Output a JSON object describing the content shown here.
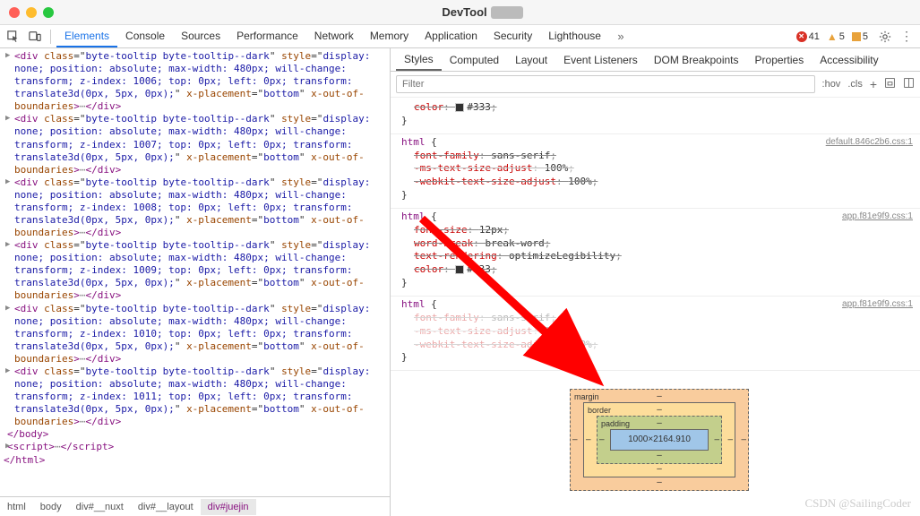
{
  "window": {
    "title": "DevTool"
  },
  "tabs": {
    "items": [
      "Elements",
      "Console",
      "Sources",
      "Performance",
      "Network",
      "Memory",
      "Application",
      "Security",
      "Lighthouse"
    ],
    "active": 0
  },
  "errors": {
    "error_count": "41",
    "warn_count": "5",
    "issue_count": "5"
  },
  "subtabs": {
    "items": [
      "Styles",
      "Computed",
      "Layout",
      "Event Listeners",
      "DOM Breakpoints",
      "Properties",
      "Accessibility"
    ],
    "active": 0
  },
  "filter": {
    "placeholder": "Filter",
    "opts": [
      ":hov",
      ".cls"
    ]
  },
  "dom_nodes": [
    {
      "tag": "div",
      "class": "byte-tooltip byte-tooltip--dark",
      "style": "display: none; position: absolute; max-width: 480px; will-change: transform; z-index: 1006; top: 0px; left: 0px; transform: translate3d(0px, 5px, 0px);",
      "xpl": "bottom",
      "xob": true
    },
    {
      "tag": "div",
      "class": "byte-tooltip byte-tooltip--dark",
      "style": "display: none; position: absolute; max-width: 480px; will-change: transform; z-index: 1007; top: 0px; left: 0px; transform: translate3d(0px, 5px, 0px);",
      "xpl": "bottom",
      "xob": true
    },
    {
      "tag": "div",
      "class": "byte-tooltip byte-tooltip--dark",
      "style": "display: none; position: absolute; max-width: 480px; will-change: transform; z-index: 1008; top: 0px; left: 0px; transform: translate3d(0px, 5px, 0px);",
      "xpl": "bottom",
      "xob": true
    },
    {
      "tag": "div",
      "class": "byte-tooltip byte-tooltip--dark",
      "style": "display: none; position: absolute; max-width: 480px; will-change: transform; z-index: 1009; top: 0px; left: 0px; transform: translate3d(0px, 5px, 0px);",
      "xpl": "bottom",
      "xob": true
    },
    {
      "tag": "div",
      "class": "byte-tooltip byte-tooltip--dark",
      "style": "display: none; position: absolute; max-width: 480px; will-change: transform; z-index: 1010; top: 0px; left: 0px; transform: translate3d(0px, 5px, 0px);",
      "xpl": "bottom",
      "xob": true
    },
    {
      "tag": "div",
      "class": "byte-tooltip byte-tooltip--dark",
      "style": "display: none; position: absolute; max-width: 480px; will-change: transform; z-index: 1011; top: 0px; left: 0px; transform: translate3d(0px, 5px, 0px);",
      "xpl": "bottom",
      "xob": true
    }
  ],
  "dom_tail": {
    "body_close": "</body>",
    "script_open": "<script>",
    "script_close": "</script>",
    "html_close": "</html>"
  },
  "crumbs": {
    "items": [
      "html",
      "body",
      "div#__nuxt",
      "div#__layout",
      "div#juejin"
    ],
    "selected": 4
  },
  "rules": [
    {
      "selector": "",
      "source": "",
      "props": [
        {
          "k": "color",
          "v": "#333",
          "sw": true,
          "strike": true
        }
      ],
      "close": "}"
    },
    {
      "selector": "html {",
      "source": "default.846c2b6.css:1",
      "props": [
        {
          "k": "font-family",
          "v": "sans-serif",
          "strike": true
        },
        {
          "k": "-ms-text-size-adjust",
          "v": "100%",
          "strike": true,
          "gray": true
        },
        {
          "k": "-webkit-text-size-adjust",
          "v": "100%",
          "strike": true
        }
      ],
      "close": "}"
    },
    {
      "selector": "html {",
      "source": "app.f81e9f9.css:1",
      "props": [
        {
          "k": "font-size",
          "v": "12px",
          "strike": true
        },
        {
          "k": "word-break",
          "v": "break-word",
          "strike": true
        },
        {
          "k": "text-rendering",
          "v": "optimizeLegibility",
          "strike": true
        },
        {
          "k": "color",
          "v": "#333",
          "sw": true,
          "strike": true
        }
      ],
      "close": "}"
    },
    {
      "selector": "html {",
      "source": "app.f81e9f9.css:1",
      "props": [
        {
          "k": "font-family",
          "v": "sans-serif",
          "strike": true,
          "obscured": true
        },
        {
          "k": "-ms-text-size-adjust",
          "v": "100%",
          "strike": true,
          "gray": true,
          "obscured": true
        },
        {
          "k": "-webkit-text-size-adjust",
          "v": "100%",
          "strike": true,
          "obscured": true
        }
      ],
      "close": "}"
    }
  ],
  "box_model": {
    "margin": "margin",
    "border": "border",
    "padding": "padding",
    "content": "1000×2164.910",
    "dashes": "–"
  },
  "watermark": "CSDN @SailingCoder"
}
